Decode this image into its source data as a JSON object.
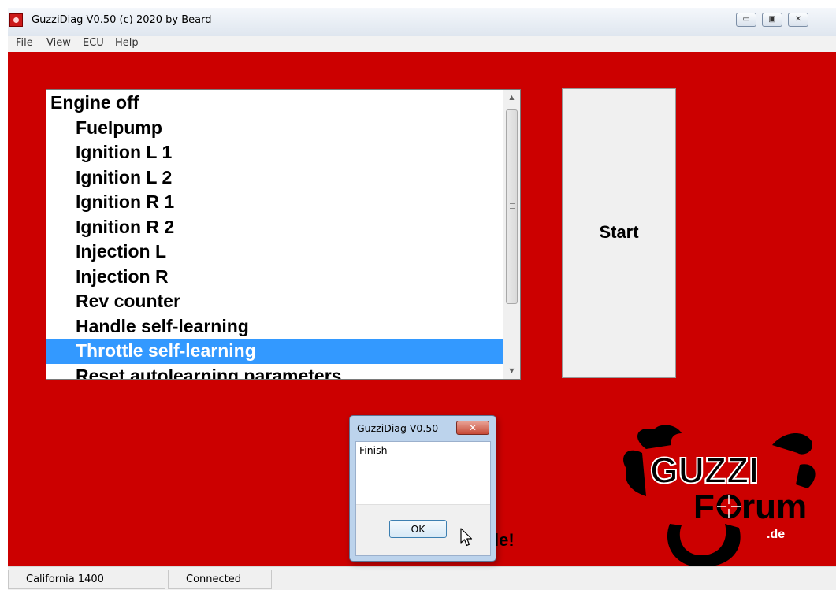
{
  "window": {
    "title": "GuzziDiag V0.50  (c) 2020 by Beard",
    "minimize": "▭",
    "maximize": "▣",
    "close": "✕"
  },
  "menu": [
    "File",
    "View",
    "ECU",
    "Help"
  ],
  "list": {
    "items": [
      {
        "label": "Engine off",
        "kind": "header"
      },
      {
        "label": "Fuelpump",
        "kind": "sub"
      },
      {
        "label": "Ignition L 1",
        "kind": "sub"
      },
      {
        "label": "Ignition L 2",
        "kind": "sub"
      },
      {
        "label": "Ignition R 1",
        "kind": "sub"
      },
      {
        "label": "Ignition R 2",
        "kind": "sub"
      },
      {
        "label": "Injection L",
        "kind": "sub"
      },
      {
        "label": "Injection R",
        "kind": "sub"
      },
      {
        "label": "Rev counter",
        "kind": "sub"
      },
      {
        "label": "Handle self-learning",
        "kind": "sub"
      },
      {
        "label": "Throttle self-learning",
        "kind": "sub",
        "selected": true
      },
      {
        "label": "Reset autolearning parameters",
        "kind": "sub"
      }
    ],
    "selection_color": "#3399ff"
  },
  "start_button": "Start",
  "behind_dialog_text": "le!",
  "logo": {
    "line1": "GUZZI",
    "line2": "F",
    "line3": "rum",
    "suffix": ".de"
  },
  "statusbar": {
    "model": "California 1400",
    "connection": "Connected"
  },
  "dialog": {
    "title": "GuzziDiag V0.50",
    "close": "✕",
    "message": "Finish",
    "ok": "OK"
  },
  "colors": {
    "background": "#cc0000",
    "accent": "#3399ff"
  }
}
